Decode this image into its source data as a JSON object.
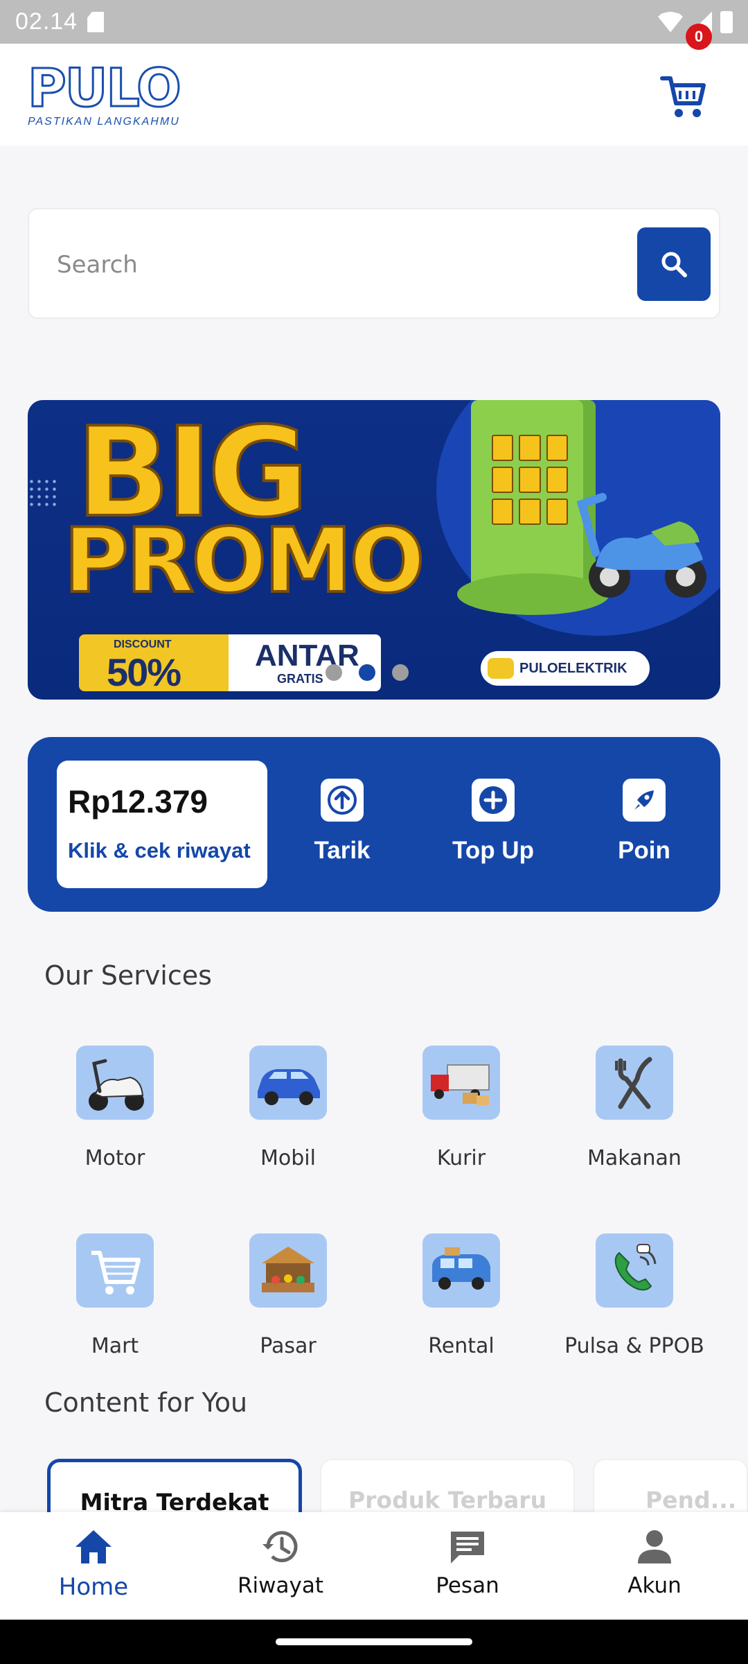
{
  "status_bar": {
    "time": "02.14"
  },
  "header": {
    "logo_text": "PULO",
    "logo_tagline": "PASTIKAN LANGKAHMU",
    "cart_count": "0"
  },
  "search": {
    "placeholder": "Search"
  },
  "banner": {
    "headline_1": "BIG",
    "headline_2": "PROMO",
    "discount_label": "DISCOUNT",
    "discount_value": "50%",
    "delivery_label": "ANTAR",
    "delivery_sub": "GRATIS",
    "brand": "PULOELEKTRIK",
    "slide_count": 3,
    "active_slide": 2
  },
  "wallet": {
    "balance": "Rp12.379",
    "history_link": "Klik & cek riwayat",
    "actions": [
      {
        "label": "Tarik",
        "icon": "arrow-up-icon"
      },
      {
        "label": "Top Up",
        "icon": "plus-icon"
      },
      {
        "label": "Poin",
        "icon": "rocket-icon"
      }
    ]
  },
  "services": {
    "title": "Our Services",
    "items": [
      {
        "label": "Motor",
        "icon": "scooter-icon"
      },
      {
        "label": "Mobil",
        "icon": "car-icon"
      },
      {
        "label": "Kurir",
        "icon": "truck-icon"
      },
      {
        "label": "Makanan",
        "icon": "fork-knife-icon"
      },
      {
        "label": "Mart",
        "icon": "cart-icon"
      },
      {
        "label": "Pasar",
        "icon": "market-stall-icon"
      },
      {
        "label": "Rental",
        "icon": "van-icon"
      },
      {
        "label": "Pulsa & PPOB",
        "icon": "phone-icon"
      }
    ]
  },
  "content": {
    "title": "Content for You",
    "tabs": [
      {
        "label": "Mitra Terdekat",
        "active": true
      },
      {
        "label": "Produk Terbaru",
        "active": false
      },
      {
        "label": "Pend...",
        "active": false
      }
    ]
  },
  "bottom_nav": {
    "items": [
      {
        "label": "Home",
        "icon": "home-icon",
        "active": true
      },
      {
        "label": "Riwayat",
        "icon": "history-icon",
        "active": false
      },
      {
        "label": "Pesan",
        "icon": "message-icon",
        "active": false
      },
      {
        "label": "Akun",
        "icon": "person-icon",
        "active": false
      }
    ]
  },
  "colors": {
    "primary": "#1547a9",
    "background": "#f6f6f8",
    "tile": "#a8c8f4",
    "badge": "#d8161b"
  }
}
